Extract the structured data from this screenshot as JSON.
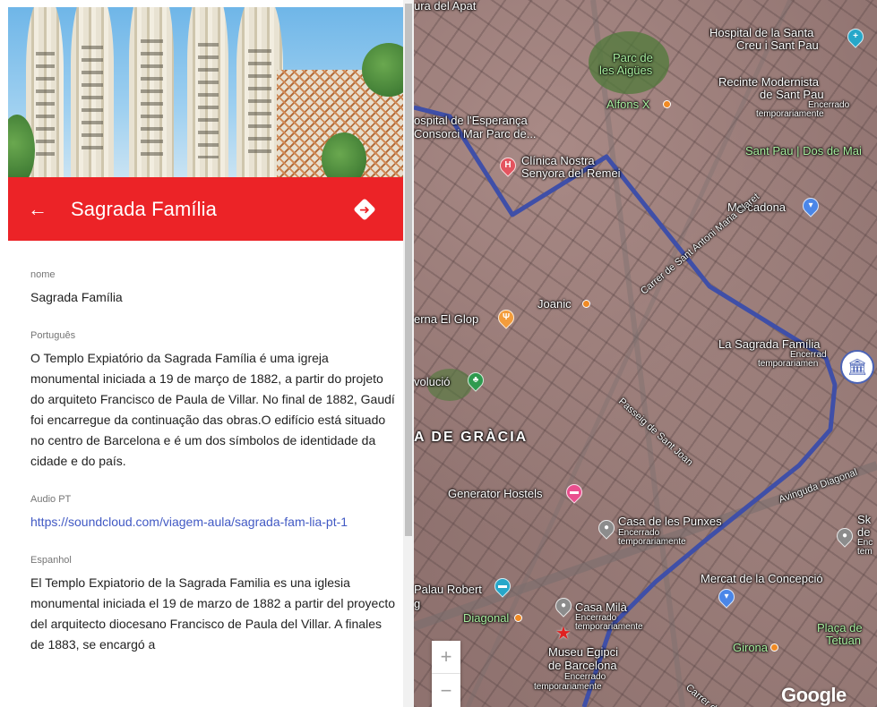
{
  "header": {
    "title": "Sagrada Família",
    "back_icon": "arrow-left-icon",
    "directions_icon": "directions-icon"
  },
  "fields": {
    "nome": {
      "label": "nome",
      "value": "Sagrada Família"
    },
    "portugues": {
      "label": "Português",
      "value": "O Templo Expiatório da Sagrada Família é uma igreja monumental iniciada a 19 de março de 1882, a partir do projeto do arquiteto Francisco de Paula de Villar. No final de 1882, Gaudí foi encarregue da continuação das obras.O edifício está situado no centro de Barcelona e é um dos símbolos de identidade da cidade e do país."
    },
    "audio_pt": {
      "label": "Audio PT",
      "value": "https://soundcloud.com/viagem-aula/sagrada-fam-lia-pt-1"
    },
    "espanhol": {
      "label": "Espanhol",
      "value": "El Templo Expiatorio de la Sagrada Familia es una iglesia monumental iniciada el 19 de marzo de 1882 a partir del proyecto del arquitecto diocesano Francisco de Paula del Villar. A finales de 1883, se encargó a"
    }
  },
  "map": {
    "labels": {
      "apat": "ura del Apat",
      "hospital_santa": "Hospital de la Santa",
      "creu_sant_pau": "Creu i Sant Pau",
      "parc_aigues_1": "Parc de",
      "parc_aigues_2": "les Aigües",
      "recinte_1": "Recinte Modernista",
      "recinte_2": "de Sant Pau",
      "recinte_closed_1": "Encerrado",
      "recinte_closed_2": "temporariamente",
      "alfons": "Alfons X",
      "esperanca_1": "ospital de l'Esperança",
      "esperanca_2": "Consorci Mar Parc de...",
      "clinica_1": "Clínica Nostra",
      "clinica_2": "Senyora del Remei",
      "sant_pau_dos": "Sant Pau | Dos de Mai",
      "mercadona": "Mercadona",
      "antoni_maria": "Carrer de Sant Antoni Maria Claret",
      "joanic": "Joanic",
      "el_glop": "erna El Glop",
      "sagrada_map": "La Sagrada Família",
      "sagrada_closed_1": "Encerrad",
      "sagrada_closed_2": "temporariamen",
      "revolucio": "volució",
      "passeig": "Passeig de Sant Joan",
      "gracia": "A DE GRÀCIA",
      "generator": "Generator Hostels",
      "avinguda": "Avinguda Diagonal",
      "punxes_1": "Casa de les Punxes",
      "punxes_2": "Encerrado",
      "punxes_3": "temporariamente",
      "sk_1": "Sk",
      "sk_2": "de",
      "sk_3": "Enc",
      "sk_4": "tem",
      "mercat": "Mercat de la Concepció",
      "palau": "Palau Robert",
      "g": "g",
      "casa_mila_1": "Casa Milà",
      "casa_mila_2": "Encerrado",
      "casa_mila_3": "temporariamente",
      "diagonal": "Diagonal",
      "placa_1": "Plaça de",
      "placa_2": "Tetuan",
      "girona": "Girona",
      "museu_1": "Museu Egipci",
      "museu_2": "de Barcelona",
      "museu_3": "Encerrado",
      "museu_4": "temporariamente",
      "carrer": "Carrer de",
      "google": "Google My"
    },
    "zoom_in": "+",
    "zoom_out": "−",
    "route_color": "#3f4fa8"
  },
  "colors": {
    "header_bg": "#ec2327",
    "link": "#4159c4"
  }
}
